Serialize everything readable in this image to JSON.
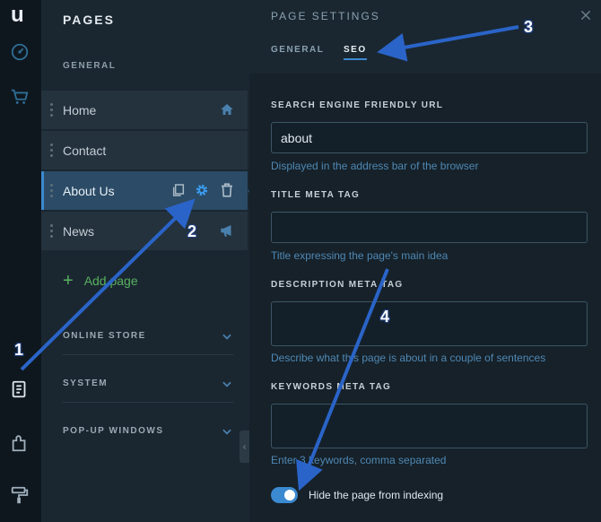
{
  "rail": {
    "logo": "u",
    "icons": [
      "dashboard-icon",
      "cart-icon",
      "pages-icon",
      "plugins-icon",
      "paint-roller-icon"
    ]
  },
  "pages_panel": {
    "title": "PAGES",
    "general_label": "GENERAL",
    "items": [
      {
        "label": "Home",
        "trail_icon": "home-icon"
      },
      {
        "label": "Contact"
      },
      {
        "label": "About Us",
        "active": true,
        "actions": [
          "duplicate-icon",
          "gear-icon",
          "trash-icon"
        ]
      },
      {
        "label": "News",
        "trail_icon": "megaphone-icon"
      }
    ],
    "add_page": "Add page",
    "sections": [
      "ONLINE STORE",
      "SYSTEM",
      "POP-UP WINDOWS"
    ]
  },
  "settings": {
    "title": "PAGE SETTINGS",
    "tabs": {
      "general": "GENERAL",
      "seo": "SEO"
    },
    "active_tab": "SEO",
    "url": {
      "label": "SEARCH ENGINE FRIENDLY URL",
      "value": "about",
      "hint": "Displayed in the address bar of the browser"
    },
    "title_tag": {
      "label": "TITLE META TAG",
      "value": "",
      "hint": "Title expressing the page's main idea"
    },
    "description_tag": {
      "label": "DESCRIPTION META TAG",
      "value": "",
      "hint": "Describe what this page is about in a couple of sentences"
    },
    "keywords_tag": {
      "label": "KEYWORDS META TAG",
      "value": "",
      "hint": "Enter 3 keywords, comma separated"
    },
    "hide_toggle": {
      "label": "Hide the page from indexing",
      "on": true
    }
  },
  "annotations": [
    "1",
    "2",
    "3",
    "4"
  ],
  "colors": {
    "accent": "#3b89d0",
    "add_green": "#59b05f",
    "arrow": "#2a64c8"
  }
}
